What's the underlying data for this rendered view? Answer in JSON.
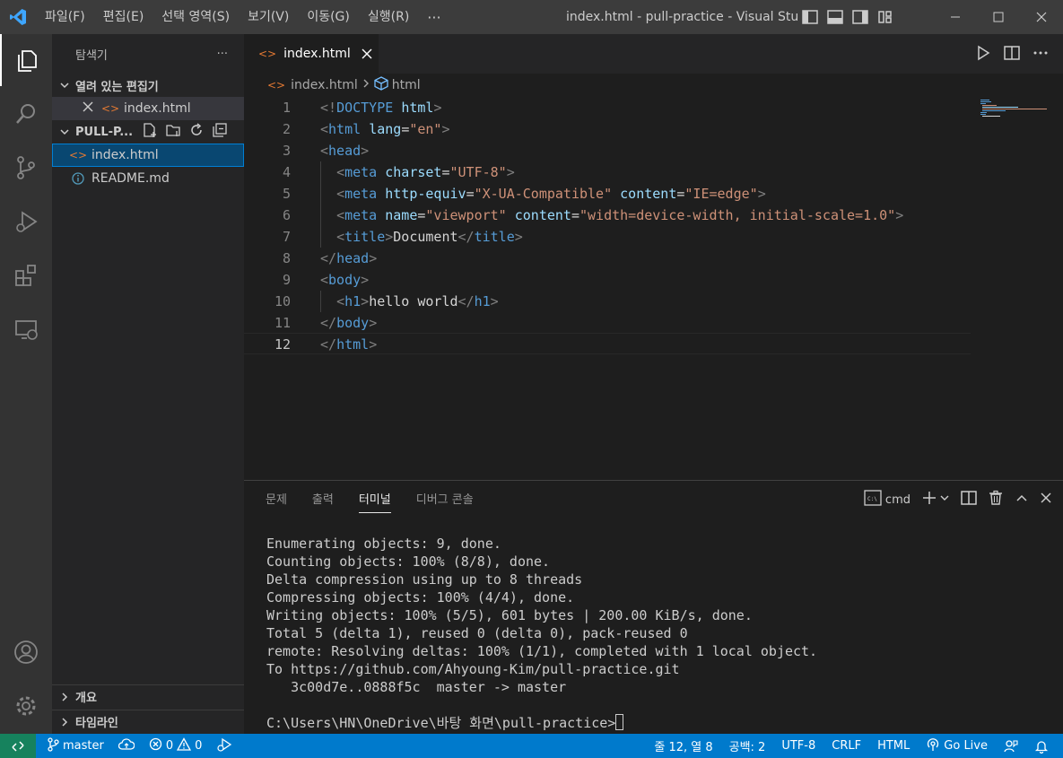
{
  "menu": [
    "파일(F)",
    "편집(E)",
    "선택 영역(S)",
    "보기(V)",
    "이동(G)",
    "실행(R)"
  ],
  "menu_more": "···",
  "window_title": "index.html - pull-practice - Visual Stu...",
  "sidebar": {
    "title": "탐색기",
    "more": "···",
    "open_editors_label": "열려 있는 편집기",
    "open_editor_file": "index.html",
    "project_label": "PULL-P...",
    "files": [
      "index.html",
      "README.md"
    ],
    "outline_label": "개요",
    "timeline_label": "타임라인"
  },
  "tab": {
    "label": "index.html"
  },
  "breadcrumb": {
    "file": "index.html",
    "symbol": "html"
  },
  "code": {
    "line_numbers": [
      "1",
      "2",
      "3",
      "4",
      "5",
      "6",
      "7",
      "8",
      "9",
      "10",
      "11",
      "12"
    ],
    "current_line": 12
  },
  "panel": {
    "tabs": [
      "문제",
      "출력",
      "터미널",
      "디버그 콘솔"
    ],
    "active_tab": "터미널",
    "shell": "cmd",
    "terminal_lines": [
      "Enumerating objects: 9, done.",
      "Counting objects: 100% (8/8), done.",
      "Delta compression using up to 8 threads",
      "Compressing objects: 100% (4/4), done.",
      "Writing objects: 100% (5/5), 601 bytes | 200.00 KiB/s, done.",
      "Total 5 (delta 1), reused 0 (delta 0), pack-reused 0",
      "remote: Resolving deltas: 100% (1/1), completed with 1 local object.",
      "To https://github.com/Ahyoung-Kim/pull-practice.git",
      "   3c00d7e..0888f5c  master -> master",
      ""
    ],
    "prompt": "C:\\Users\\HN\\OneDrive\\바탕 화면\\pull-practice>"
  },
  "status": {
    "branch": "master",
    "errors": "0",
    "warnings": "0",
    "position": "줄 12, 열 8",
    "spaces": "공백: 2",
    "encoding": "UTF-8",
    "eol": "CRLF",
    "language": "HTML",
    "golive": "Go Live"
  },
  "colors": {
    "accent": "#007acc",
    "remote": "#16825d",
    "tag": "#569cd6",
    "attr": "#9cdcfe",
    "string": "#ce9178"
  }
}
